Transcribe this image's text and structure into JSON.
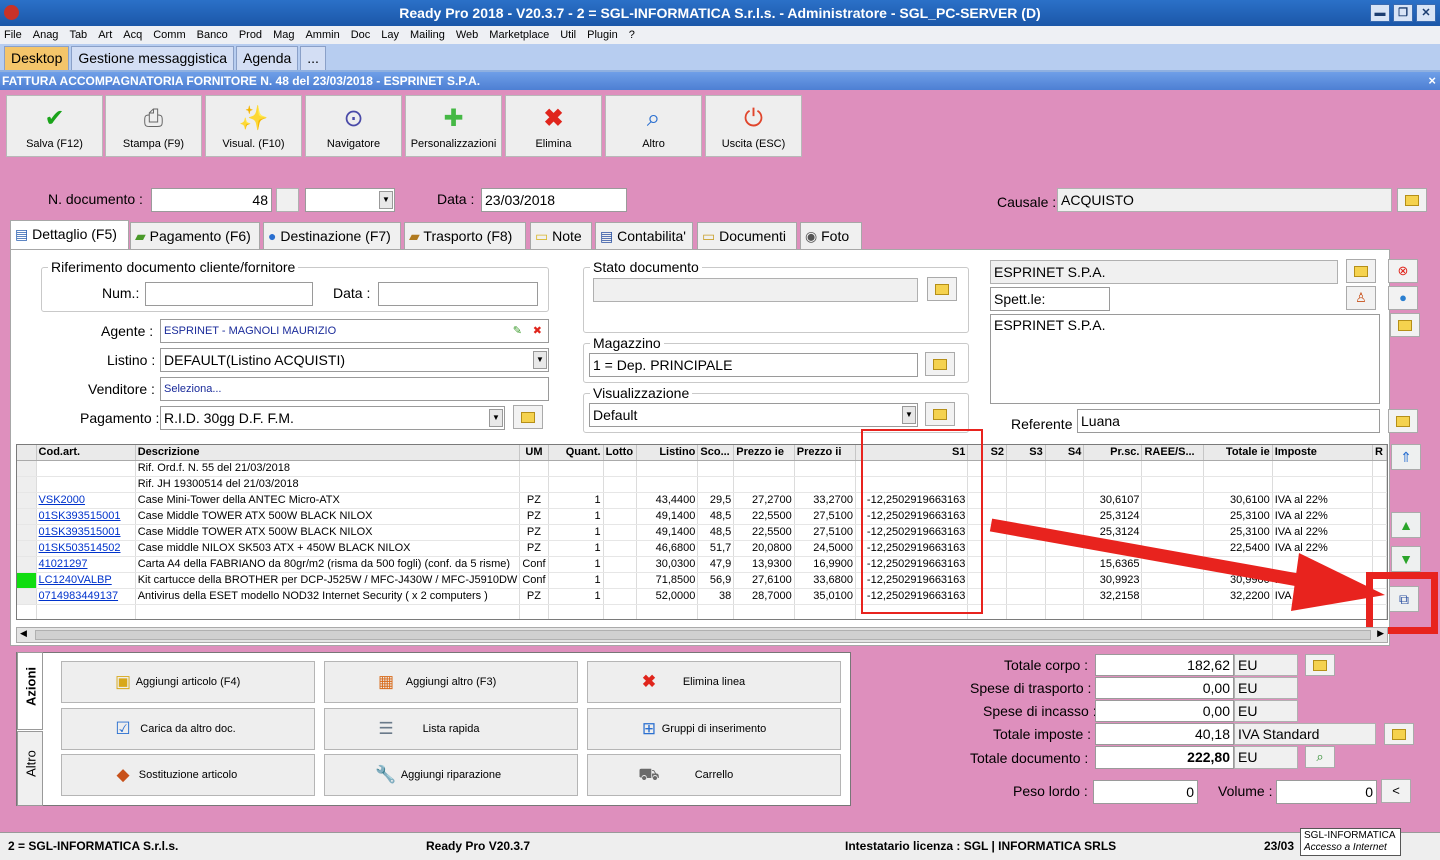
{
  "window": {
    "title": "Ready Pro 2018 - V20.3.7 - 2 = SGL-INFORMATICA S.r.l.s. - Administratore - SGL_PC-SERVER (D)",
    "btn_min": "▬",
    "btn_restore": "❐",
    "btn_close": "✕"
  },
  "menu": [
    "File",
    "Anag",
    "Tab",
    "Art",
    "Acq",
    "Comm",
    "Banco",
    "Prod",
    "Mag",
    "Ammin",
    "Doc",
    "Lay",
    "Mailing",
    "Web",
    "Marketplace",
    "Util",
    "Plugin",
    "?"
  ],
  "top_tabs": [
    "Desktop",
    "Gestione messaggistica",
    "Agenda",
    "..."
  ],
  "doc_title": "FATTURA ACCOMPAGNATORIA FORNITORE N. 48 del 23/03/2018 - ESPRINET S.P.A.",
  "close_x": "×",
  "toolbar": {
    "save": "Salva (F12)",
    "print": "Stampa (F9)",
    "view": "Visual. (F10)",
    "navigator": "Navigatore",
    "customize": "Personalizzazioni",
    "delete": "Elimina",
    "other": "Altro",
    "exit": "Uscita (ESC)"
  },
  "header": {
    "ndoc_label": "N. documento :",
    "ndoc_value": "48",
    "date_label": "Data :",
    "date_value": "23/03/2018",
    "causale_label": "Causale :",
    "causale_value": "ACQUISTO"
  },
  "doc_tabs": [
    "Dettaglio (F5)",
    "Pagamento (F6)",
    "Destinazione (F7)",
    "Trasporto (F8)",
    "Note",
    "Contabilita'",
    "Documenti",
    "Foto"
  ],
  "rif": {
    "title": "Riferimento documento cliente/fornitore",
    "num_label": "Num.:",
    "data_label": "Data :"
  },
  "agente": {
    "label": "Agente :",
    "value": "ESPRINET - MAGNOLI MAURIZIO"
  },
  "listino": {
    "label": "Listino :",
    "value": "DEFAULT(Listino ACQUISTI)"
  },
  "venditore": {
    "label": "Venditore :",
    "value": "Seleziona..."
  },
  "pagamento": {
    "label": "Pagamento :",
    "value": "R.I.D. 30gg D.F. F.M."
  },
  "stato": {
    "title": "Stato documento"
  },
  "magazzino": {
    "title": "Magazzino",
    "value": "1 = Dep. PRINCIPALE"
  },
  "visualizzazione": {
    "title": "Visualizzazione",
    "value": "Default"
  },
  "cliente": {
    "name": "ESPRINET S.P.A.",
    "spett": "Spett.le:",
    "address": "ESPRINET S.P.A.",
    "referente_label": "Referente",
    "referente_value": "Luana"
  },
  "grid": {
    "columns": [
      "Cod.art.",
      "Descrizione",
      "UM",
      "Quant.",
      "Lotto",
      "Listino",
      "Sco...",
      "Prezzo ie",
      "Prezzo ii",
      "S1",
      "S2",
      "S3",
      "S4",
      "Pr.sc.",
      "RAEE/S...",
      "Totale ie",
      "Imposte",
      "R"
    ],
    "rows": [
      {
        "ind": "",
        "code": "",
        "desc": "Rif. Ord.f. N. 55 del 21/03/2018",
        "um": "",
        "qty": "",
        "lotto": "",
        "listino": "",
        "sco": "",
        "pie": "",
        "pii": "",
        "s1": "",
        "s2": "",
        "s3": "",
        "s4": "",
        "prsc": "",
        "raee": "",
        "tot": "",
        "imp": ""
      },
      {
        "ind": "",
        "code": "",
        "desc": "Rif. JH 19300514 del 21/03/2018",
        "um": "",
        "qty": "",
        "lotto": "",
        "listino": "",
        "sco": "",
        "pie": "",
        "pii": "",
        "s1": "",
        "s2": "",
        "s3": "",
        "s4": "",
        "prsc": "",
        "raee": "",
        "tot": "",
        "imp": ""
      },
      {
        "ind": "",
        "code": "VSK2000",
        "desc": "Case Mini-Tower della ANTEC Micro-ATX",
        "um": "PZ",
        "qty": "1",
        "lotto": "",
        "listino": "43,4400",
        "sco": "29,5",
        "pie": "27,2700",
        "pii": "33,2700",
        "s1": "-12,2502919663163",
        "s2": "",
        "s3": "",
        "s4": "",
        "prsc": "30,6107",
        "raee": "",
        "tot": "30,6100",
        "imp": "IVA al 22%"
      },
      {
        "ind": "",
        "code": "01SK393515001",
        "desc": "Case Middle TOWER ATX 500W BLACK NILOX",
        "um": "PZ",
        "qty": "1",
        "lotto": "",
        "listino": "49,1400",
        "sco": "48,5",
        "pie": "22,5500",
        "pii": "27,5100",
        "s1": "-12,2502919663163",
        "s2": "",
        "s3": "",
        "s4": "",
        "prsc": "25,3124",
        "raee": "",
        "tot": "25,3100",
        "imp": "IVA al 22%"
      },
      {
        "ind": "",
        "code": "01SK393515001",
        "desc": "Case Middle TOWER ATX 500W BLACK NILOX",
        "um": "PZ",
        "qty": "1",
        "lotto": "",
        "listino": "49,1400",
        "sco": "48,5",
        "pie": "22,5500",
        "pii": "27,5100",
        "s1": "-12,2502919663163",
        "s2": "",
        "s3": "",
        "s4": "",
        "prsc": "25,3124",
        "raee": "",
        "tot": "25,3100",
        "imp": "IVA al 22%"
      },
      {
        "ind": "",
        "code": "01SK503514502",
        "desc": "Case middle NILOX SK503 ATX + 450W BLACK NILOX",
        "um": "PZ",
        "qty": "1",
        "lotto": "",
        "listino": "46,6800",
        "sco": "51,7",
        "pie": "20,0800",
        "pii": "24,5000",
        "s1": "-12,2502919663163",
        "s2": "",
        "s3": "",
        "s4": "",
        "prsc": "",
        "raee": "",
        "tot": "22,5400",
        "imp": "IVA al 22%"
      },
      {
        "ind": "",
        "code": "41021297",
        "desc": "Carta A4 della FABRIANO da 80gr/m2 (risma da 500 fogli) (conf. da 5 risme)",
        "um": "Conf",
        "qty": "1",
        "lotto": "",
        "listino": "30,0300",
        "sco": "47,9",
        "pie": "13,9300",
        "pii": "16,9900",
        "s1": "-12,2502919663163",
        "s2": "",
        "s3": "",
        "s4": "",
        "prsc": "15,6365",
        "raee": "",
        "tot": "",
        "imp": ""
      },
      {
        "ind": "green",
        "code": "LC1240VALBP",
        "desc": "Kit cartucce della BROTHER per DCP-J525W / MFC-J430W / MFC-J5910DW",
        "um": "Conf",
        "qty": "1",
        "lotto": "",
        "listino": "71,8500",
        "sco": "56,9",
        "pie": "27,6100",
        "pii": "33,6800",
        "s1": "-12,2502919663163",
        "s2": "",
        "s3": "",
        "s4": "",
        "prsc": "30,9923",
        "raee": "",
        "tot": "30,9900",
        "imp": "IVA al 22%"
      },
      {
        "ind": "",
        "code": "0714983449137",
        "desc": "Antivirus della ESET modello NOD32 Internet Security ( x 2 computers )",
        "um": "PZ",
        "qty": "1",
        "lotto": "",
        "listino": "52,0000",
        "sco": "38",
        "pie": "28,7000",
        "pii": "35,0100",
        "s1": "-12,2502919663163",
        "s2": "",
        "s3": "",
        "s4": "",
        "prsc": "32,2158",
        "raee": "",
        "tot": "32,2200",
        "imp": "IVA al"
      }
    ]
  },
  "actions_tabs": [
    "Azioni",
    "Altro"
  ],
  "actions": {
    "add_article": "Aggiungi articolo (F4)",
    "add_other": "Aggiungi altro (F3)",
    "delete_line": "Elimina linea",
    "load_doc": "Carica da altro doc.",
    "quick_list": "Lista rapida",
    "insert_groups": "Gruppi di inserimento",
    "substitute": "Sostituzione articolo",
    "add_repair": "Aggiungi riparazione",
    "cart": "Carrello"
  },
  "totals": {
    "corpo_label": "Totale corpo :",
    "corpo_value": "182,62",
    "corpo_cur": "EU",
    "trasporto_label": "Spese di trasporto :",
    "trasporto_value": "0,00",
    "trasporto_cur": "EU",
    "incasso_label": "Spese di incasso :",
    "incasso_value": "0,00",
    "incasso_cur": "EU",
    "imposte_label": "Totale imposte :",
    "imposte_value": "40,18",
    "imposte_type": "IVA Standard",
    "documento_label": "Totale documento :",
    "documento_value": "222,80",
    "documento_cur": "EU",
    "peso_label": "Peso lordo :",
    "peso_value": "0",
    "volume_label": "Volume :",
    "volume_value": "0",
    "volume_btn": "<"
  },
  "status": {
    "company": "2 = SGL-INFORMATICA S.r.l.s.",
    "version": "Ready Pro V20.3.7",
    "license": "Intestatario licenza : SGL | INFORMATICA SRLS",
    "date": "23/03",
    "tooltip_title": "SGL-INFORMATICA",
    "tooltip_sub": "Accesso a Internet"
  },
  "colors": {
    "background": "#de8fbd",
    "title": "#1b57a8",
    "annotation": "#e8231e"
  }
}
